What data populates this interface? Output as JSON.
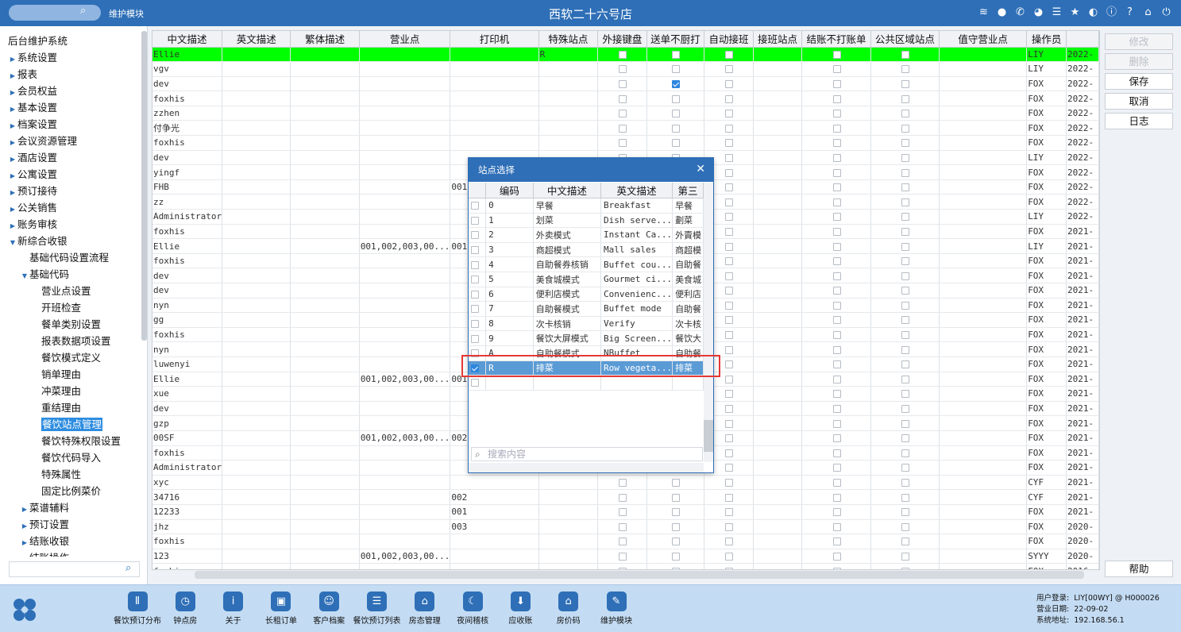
{
  "topbar": {
    "module_label": "维护模块",
    "app_title": "西软二十六号店",
    "icons": [
      "wifi-icon",
      "chat-icon",
      "phone-icon",
      "palette-icon",
      "menu-icon",
      "star-icon",
      "theme-icon",
      "info-icon",
      "help-icon",
      "home-icon",
      "power-icon"
    ]
  },
  "sidebar": {
    "root": "后台维护系统",
    "items": [
      {
        "label": "系统设置",
        "level": 1,
        "arrow": "▶"
      },
      {
        "label": "报表",
        "level": 1,
        "arrow": "▶"
      },
      {
        "label": "会员权益",
        "level": 1,
        "arrow": "▶"
      },
      {
        "label": "基本设置",
        "level": 1,
        "arrow": "▶"
      },
      {
        "label": "档案设置",
        "level": 1,
        "arrow": "▶"
      },
      {
        "label": "会议资源管理",
        "level": 1,
        "arrow": "▶"
      },
      {
        "label": "酒店设置",
        "level": 1,
        "arrow": "▶"
      },
      {
        "label": "公寓设置",
        "level": 1,
        "arrow": "▶"
      },
      {
        "label": "预订接待",
        "level": 1,
        "arrow": "▶"
      },
      {
        "label": "公关销售",
        "level": 1,
        "arrow": "▶"
      },
      {
        "label": "账务审核",
        "level": 1,
        "arrow": "▶"
      },
      {
        "label": "新综合收银",
        "level": 1,
        "arrow": "▼"
      },
      {
        "label": "基础代码设置流程",
        "level": 2,
        "arrow": ""
      },
      {
        "label": "基础代码",
        "level": 2,
        "arrow": "▼"
      },
      {
        "label": "营业点设置",
        "level": 3,
        "arrow": ""
      },
      {
        "label": "开班检查",
        "level": 3,
        "arrow": ""
      },
      {
        "label": "餐单类别设置",
        "level": 3,
        "arrow": ""
      },
      {
        "label": "报表数据项设置",
        "level": 3,
        "arrow": ""
      },
      {
        "label": "餐饮模式定义",
        "level": 3,
        "arrow": ""
      },
      {
        "label": "销单理由",
        "level": 3,
        "arrow": ""
      },
      {
        "label": "冲菜理由",
        "level": 3,
        "arrow": ""
      },
      {
        "label": "重结理由",
        "level": 3,
        "arrow": ""
      },
      {
        "label": "餐饮站点管理",
        "level": 3,
        "arrow": "",
        "selected": true
      },
      {
        "label": "餐饮特殊权限设置",
        "level": 3,
        "arrow": ""
      },
      {
        "label": "餐饮代码导入",
        "level": 3,
        "arrow": ""
      },
      {
        "label": "特殊属性",
        "level": 3,
        "arrow": ""
      },
      {
        "label": "固定比例菜价",
        "level": 3,
        "arrow": ""
      },
      {
        "label": "菜谱辅料",
        "level": 2,
        "arrow": "▶"
      },
      {
        "label": "预订设置",
        "level": 2,
        "arrow": "▶"
      },
      {
        "label": "结账收银",
        "level": 2,
        "arrow": "▶"
      },
      {
        "label": "结账操作",
        "level": 2,
        "arrow": "▶"
      }
    ]
  },
  "grid": {
    "columns": [
      "中文描述",
      "英文描述",
      "繁体描述",
      "营业点",
      "打印机",
      "特殊站点",
      "外接键盘",
      "送单不厨打",
      "自动接班",
      "接班站点",
      "结账不打账单",
      "公共区域站点",
      "值守营业点",
      "操作员",
      ""
    ],
    "rows": [
      [
        "Ellie",
        "",
        "",
        "",
        "",
        "R",
        0,
        0,
        0,
        "",
        0,
        0,
        "",
        "LIY",
        "2022-"
      ],
      [
        "vgv",
        "",
        "",
        "",
        "",
        "",
        0,
        0,
        0,
        "",
        0,
        0,
        "",
        "LIY",
        "2022-"
      ],
      [
        "dev",
        "",
        "",
        "",
        "",
        "",
        0,
        1,
        0,
        "",
        0,
        0,
        "",
        "FOX",
        "2022-"
      ],
      [
        "foxhis",
        "",
        "",
        "",
        "",
        "",
        0,
        0,
        0,
        "",
        0,
        0,
        "",
        "FOX",
        "2022-"
      ],
      [
        "zzhen",
        "",
        "",
        "",
        "",
        "",
        0,
        0,
        0,
        "",
        0,
        0,
        "",
        "FOX",
        "2022-"
      ],
      [
        "付争光",
        "",
        "",
        "",
        "",
        "",
        0,
        0,
        0,
        "",
        0,
        0,
        "",
        "FOX",
        "2022-"
      ],
      [
        "foxhis",
        "",
        "",
        "",
        "",
        "",
        0,
        0,
        0,
        "",
        0,
        0,
        "",
        "FOX",
        "2022-"
      ],
      [
        "dev",
        "",
        "",
        "",
        "",
        "",
        0,
        0,
        0,
        "",
        0,
        0,
        "",
        "LIY",
        "2022-"
      ],
      [
        "yingf",
        "",
        "",
        "",
        "",
        "",
        0,
        0,
        0,
        "",
        0,
        0,
        "",
        "FOX",
        "2022-"
      ],
      [
        "FHB",
        "",
        "",
        "",
        "001,",
        "",
        0,
        0,
        0,
        "",
        0,
        0,
        "",
        "FOX",
        "2022-"
      ],
      [
        "zz",
        "",
        "",
        "",
        "",
        "",
        0,
        0,
        0,
        "",
        0,
        0,
        "",
        "FOX",
        "2022-"
      ],
      [
        "Administrator",
        "",
        "",
        "",
        "",
        "",
        0,
        0,
        0,
        "",
        0,
        0,
        "",
        "LIY",
        "2022-"
      ],
      [
        "foxhis",
        "",
        "",
        "",
        "",
        "",
        0,
        0,
        0,
        "",
        0,
        0,
        "",
        "FOX",
        "2021-"
      ],
      [
        "Ellie",
        "",
        "",
        "001,002,003,00...",
        "001,",
        "",
        0,
        0,
        0,
        "",
        0,
        0,
        "",
        "LIY",
        "2021-"
      ],
      [
        "foxhis",
        "",
        "",
        "",
        "",
        "",
        0,
        0,
        0,
        "",
        0,
        0,
        "",
        "FOX",
        "2021-"
      ],
      [
        "dev",
        "",
        "",
        "",
        "",
        "",
        0,
        0,
        0,
        "",
        0,
        0,
        "",
        "FOX",
        "2021-"
      ],
      [
        "dev",
        "",
        "",
        "",
        "",
        "",
        0,
        0,
        0,
        "",
        0,
        0,
        "",
        "FOX",
        "2021-"
      ],
      [
        "nyn",
        "",
        "",
        "",
        "",
        "",
        0,
        0,
        0,
        "",
        0,
        0,
        "",
        "FOX",
        "2021-"
      ],
      [
        "gg",
        "",
        "",
        "",
        "",
        "",
        0,
        0,
        0,
        "",
        0,
        0,
        "",
        "FOX",
        "2021-"
      ],
      [
        "foxhis",
        "",
        "",
        "",
        "",
        "",
        0,
        0,
        0,
        "",
        0,
        0,
        "",
        "FOX",
        "2021-"
      ],
      [
        "nyn",
        "",
        "",
        "",
        "",
        "",
        0,
        0,
        0,
        "",
        0,
        0,
        "",
        "FOX",
        "2021-"
      ],
      [
        "luwenyi",
        "",
        "",
        "",
        "",
        "",
        0,
        0,
        0,
        "",
        0,
        0,
        "",
        "FOX",
        "2021-"
      ],
      [
        "Ellie",
        "",
        "",
        "001,002,003,00...",
        "001,",
        "",
        0,
        0,
        0,
        "",
        0,
        0,
        "",
        "FOX",
        "2021-"
      ],
      [
        "xue",
        "",
        "",
        "",
        "",
        "",
        0,
        0,
        0,
        "",
        0,
        0,
        "",
        "FOX",
        "2021-"
      ],
      [
        "dev",
        "",
        "",
        "",
        "",
        "",
        0,
        0,
        0,
        "",
        0,
        0,
        "",
        "FOX",
        "2021-"
      ],
      [
        "gzp",
        "",
        "",
        "",
        "",
        "",
        0,
        0,
        0,
        "",
        0,
        0,
        "",
        "FOX",
        "2021-"
      ],
      [
        "00SF",
        "",
        "",
        "001,002,003,00...",
        "002",
        "",
        0,
        0,
        0,
        "",
        0,
        0,
        "",
        "FOX",
        "2021-"
      ],
      [
        "foxhis",
        "",
        "",
        "",
        "",
        "",
        0,
        0,
        0,
        "",
        0,
        0,
        "",
        "FOX",
        "2021-"
      ],
      [
        "Administrator",
        "",
        "",
        "",
        "",
        "",
        0,
        0,
        0,
        "",
        0,
        0,
        "",
        "FOX",
        "2021-"
      ],
      [
        "xyc",
        "",
        "",
        "",
        "",
        "",
        0,
        0,
        0,
        "",
        0,
        0,
        "",
        "CYF",
        "2021-"
      ],
      [
        "34716",
        "",
        "",
        "",
        "002",
        "",
        0,
        0,
        0,
        "",
        0,
        0,
        "",
        "CYF",
        "2021-"
      ],
      [
        "12233",
        "",
        "",
        "",
        "001",
        "",
        0,
        0,
        0,
        "",
        0,
        0,
        "",
        "FOX",
        "2021-"
      ],
      [
        "jhz",
        "",
        "",
        "",
        "003",
        "",
        0,
        0,
        0,
        "",
        0,
        0,
        "",
        "FOX",
        "2020-"
      ],
      [
        "foxhis",
        "",
        "",
        "",
        "",
        "",
        0,
        0,
        0,
        "",
        0,
        0,
        "",
        "FOX",
        "2020-"
      ],
      [
        "123",
        "",
        "",
        "001,002,003,00...",
        "",
        "",
        0,
        0,
        0,
        "",
        0,
        0,
        "",
        "SYYY",
        "2020-"
      ],
      [
        "foxhis",
        "",
        "",
        "",
        "",
        "",
        0,
        0,
        0,
        "",
        0,
        0,
        "",
        "FOX",
        "2016-"
      ]
    ]
  },
  "right_buttons": {
    "modify": "修改",
    "delete": "删除",
    "save": "保存",
    "cancel": "取消",
    "log": "日志",
    "help": "帮助"
  },
  "dialog": {
    "title": "站点选择",
    "columns": [
      "",
      "编码",
      "中文描述",
      "英文描述",
      "第三"
    ],
    "rows": [
      [
        0,
        "0",
        "早餐",
        "Breakfast",
        "早餐"
      ],
      [
        0,
        "1",
        "划菜",
        "Dish serve...",
        "劃菜"
      ],
      [
        0,
        "2",
        "外卖模式",
        "Instant Ca...",
        "外賣模"
      ],
      [
        0,
        "3",
        "商超模式",
        "Mall sales",
        "商超模"
      ],
      [
        0,
        "4",
        "自助餐券核销",
        "Buffet cou...",
        "自助餐"
      ],
      [
        0,
        "5",
        "美食城模式",
        "Gourmet ci...",
        "美食城"
      ],
      [
        0,
        "6",
        "便利店模式",
        "Convenienc...",
        "便利店"
      ],
      [
        0,
        "7",
        "自助餐模式",
        "Buffet mode",
        "自助餐"
      ],
      [
        0,
        "8",
        "次卡核销",
        "Verify",
        "次卡核"
      ],
      [
        0,
        "9",
        "餐饮大屏模式",
        "Big Screen...",
        "餐饮大"
      ],
      [
        0,
        "A",
        "自助餐模式",
        "NBuffet",
        "自助餐"
      ],
      [
        1,
        "R",
        "排菜",
        "Row vegeta...",
        "排菜"
      ],
      [
        0,
        "",
        "",
        "",
        ""
      ]
    ],
    "selected_index": 11,
    "search_placeholder": "搜索内容"
  },
  "bottombar": {
    "items": [
      {
        "label": "餐饮预订分布",
        "icon": "Ⅱ"
      },
      {
        "label": "钟点房",
        "icon": "◷"
      },
      {
        "label": "关于",
        "icon": "i"
      },
      {
        "label": "长租订单",
        "icon": "▣"
      },
      {
        "label": "客户档案",
        "icon": "☺"
      },
      {
        "label": "餐饮预订列表",
        "icon": "☰"
      },
      {
        "label": "房态管理",
        "icon": "⌂"
      },
      {
        "label": "夜间稽核",
        "icon": "☾"
      },
      {
        "label": "应收账",
        "icon": "⬇"
      },
      {
        "label": "房价码",
        "icon": "⌂"
      },
      {
        "label": "维护模块",
        "icon": "✎"
      }
    ],
    "sysinfo": {
      "login_label": "用户登录:",
      "login_value": "LIY[00WY] @ H000026",
      "date_label": "营业日期:",
      "date_value": "22-09-02",
      "addr_label": "系统地址:",
      "addr_value": "192.168.56.1"
    }
  }
}
